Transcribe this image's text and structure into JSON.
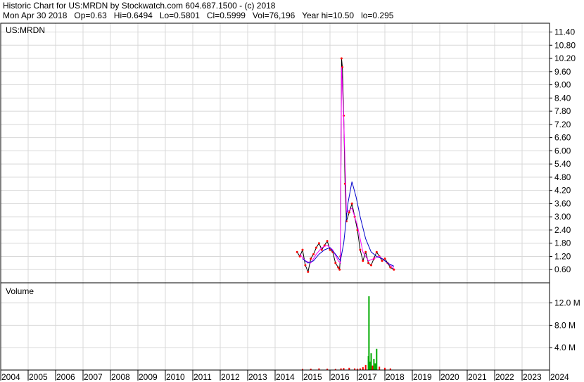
{
  "header": {
    "line1": "Historic Chart for US:MRDN by Stockwatch.com 604.687.1500 - (c) 2018",
    "line2": "Mon Apr 30 2018   Op=0.63   Hi=0.6494   Lo=0.5801   Cl=0.5999   Vol=76,196   Year hi=10.50   lo=0.295"
  },
  "chart_data": [
    {
      "type": "line",
      "label": "US:MRDN",
      "y_ticks": [
        "11.40",
        "10.80",
        "10.20",
        "9.60",
        "9.00",
        "8.40",
        "7.80",
        "7.20",
        "6.60",
        "6.00",
        "5.40",
        "4.80",
        "4.20",
        "3.60",
        "3.00",
        "2.40",
        "1.80",
        "1.20",
        "0.60"
      ],
      "ylim": [
        0,
        11.8
      ],
      "x_ticks": [
        "2004",
        "2005",
        "2006",
        "2007",
        "2008",
        "2009",
        "2010",
        "2011",
        "2012",
        "2013",
        "2014",
        "2015",
        "2016",
        "2017",
        "2018",
        "2019",
        "2020",
        "2021",
        "2022",
        "2023",
        "2024"
      ],
      "xlim": [
        2004,
        2024
      ],
      "grid": true,
      "colors": {
        "price": "#000000",
        "close_marks": "#ff0000",
        "ma_short": "#ff00ff",
        "ma_long": "#0000cc"
      },
      "series": [
        {
          "role": "price",
          "x": [
            2014.8,
            2014.9,
            2015.0,
            2015.1,
            2015.2,
            2015.3,
            2015.4,
            2015.5,
            2015.6,
            2015.7,
            2015.8,
            2015.9,
            2016.0,
            2016.1,
            2016.2,
            2016.3,
            2016.35,
            2016.38,
            2016.42,
            2016.45,
            2016.5,
            2016.55,
            2016.6,
            2016.7,
            2016.8,
            2016.9,
            2017.0,
            2017.1,
            2017.2,
            2017.3,
            2017.4,
            2017.5,
            2017.6,
            2017.7,
            2017.8,
            2017.9,
            2018.0,
            2018.1,
            2018.2,
            2018.33
          ],
          "y": [
            1.4,
            1.2,
            1.5,
            0.8,
            0.5,
            1.1,
            1.3,
            1.6,
            1.8,
            1.5,
            1.7,
            1.9,
            1.5,
            1.4,
            0.9,
            0.7,
            0.6,
            1.2,
            10.2,
            9.8,
            7.6,
            4.5,
            2.8,
            3.2,
            3.6,
            3.0,
            2.4,
            1.5,
            1.0,
            1.4,
            0.9,
            0.8,
            1.1,
            1.4,
            1.2,
            1.0,
            1.1,
            0.9,
            0.7,
            0.6
          ]
        },
        {
          "role": "ma_short",
          "x": [
            2014.9,
            2015.1,
            2015.3,
            2015.5,
            2015.7,
            2015.9,
            2016.1,
            2016.3,
            2016.38,
            2016.42,
            2016.5,
            2016.6,
            2016.8,
            2017.0,
            2017.2,
            2017.4,
            2017.6,
            2017.8,
            2018.0,
            2018.2,
            2018.33
          ],
          "y": [
            1.3,
            1.0,
            0.9,
            1.3,
            1.6,
            1.7,
            1.5,
            1.0,
            0.9,
            9.8,
            7.5,
            3.2,
            3.4,
            2.6,
            1.4,
            1.0,
            1.1,
            1.2,
            1.0,
            0.8,
            0.65
          ]
        },
        {
          "role": "ma_long",
          "x": [
            2015.0,
            2015.2,
            2015.4,
            2015.6,
            2015.8,
            2016.0,
            2016.2,
            2016.38,
            2016.5,
            2016.65,
            2016.8,
            2016.95,
            2017.1,
            2017.3,
            2017.5,
            2017.7,
            2017.9,
            2018.1,
            2018.33
          ],
          "y": [
            1.1,
            0.9,
            1.0,
            1.3,
            1.5,
            1.6,
            1.3,
            1.0,
            1.8,
            3.6,
            4.6,
            3.9,
            3.0,
            2.0,
            1.4,
            1.2,
            1.1,
            0.9,
            0.75
          ]
        }
      ]
    },
    {
      "type": "bar",
      "label": "Volume",
      "y_ticks": [
        "12.0 M",
        "8.0 M",
        "4.0 M"
      ],
      "y_tick_values": [
        12000000,
        8000000,
        4000000
      ],
      "ylim": [
        0,
        15600000
      ],
      "bar_color": "#00aa00",
      "low_bar_color": "#ff0000",
      "x": [
        2015.0,
        2015.3,
        2015.6,
        2015.9,
        2016.2,
        2016.4,
        2016.5,
        2016.7,
        2016.9,
        2017.0,
        2017.1,
        2017.2,
        2017.3,
        2017.4,
        2017.42,
        2017.45,
        2017.5,
        2017.55,
        2017.6,
        2017.65,
        2017.7,
        2017.8,
        2018.0,
        2018.2
      ],
      "values": [
        200000,
        250000,
        300000,
        250000,
        200000,
        300000,
        350000,
        400000,
        300000,
        250000,
        300000,
        500000,
        900000,
        2500000,
        13200000,
        1500000,
        3000000,
        800000,
        2000000,
        1200000,
        3800000,
        600000,
        400000,
        300000
      ]
    }
  ]
}
